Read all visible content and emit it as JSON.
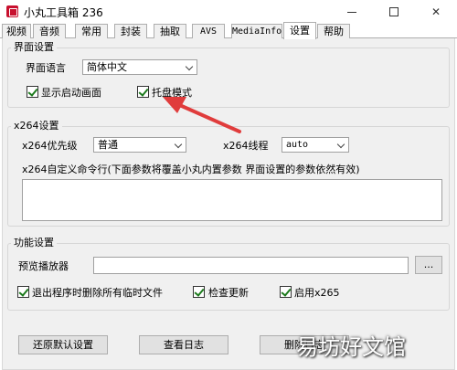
{
  "window": {
    "title": "小丸工具箱 236"
  },
  "tabs": [
    {
      "label": "视频"
    },
    {
      "label": "音频"
    },
    {
      "label": "常用"
    },
    {
      "label": "封装"
    },
    {
      "label": "抽取"
    },
    {
      "label": "AVS"
    },
    {
      "label": "MediaInfo"
    },
    {
      "label": "设置"
    },
    {
      "label": "帮助"
    }
  ],
  "interface_settings": {
    "group_title": "界面设置",
    "language_label": "界面语言",
    "language_value": "简体中文",
    "show_splash_label": "显示启动画面",
    "show_splash_checked": true,
    "tray_mode_label": "托盘模式",
    "tray_mode_checked": true
  },
  "x264_settings": {
    "group_title": "x264设置",
    "priority_label": "x264优先级",
    "priority_value": "普通",
    "threads_label": "x264线程",
    "threads_value": "auto",
    "custom_cmd_label": "x264自定义命令行(下面参数将覆盖小丸内置参数 界面设置的参数依然有效)",
    "custom_cmd_value": ""
  },
  "function_settings": {
    "group_title": "功能设置",
    "preview_player_label": "预览播放器",
    "preview_player_value": "",
    "browse_label": "...",
    "delete_temp_label": "退出程序时删除所有临时文件",
    "delete_temp_checked": true,
    "check_update_label": "检查更新",
    "check_update_checked": true,
    "enable_x265_label": "启用x265",
    "enable_x265_checked": true
  },
  "buttons": {
    "restore_defaults": "还原默认设置",
    "view_log": "查看日志",
    "delete_log": "删除日志"
  },
  "watermark": "易坊好文馆",
  "colors": {
    "accent_check": "#1c7a1c",
    "arrow": "#e03c3c"
  }
}
